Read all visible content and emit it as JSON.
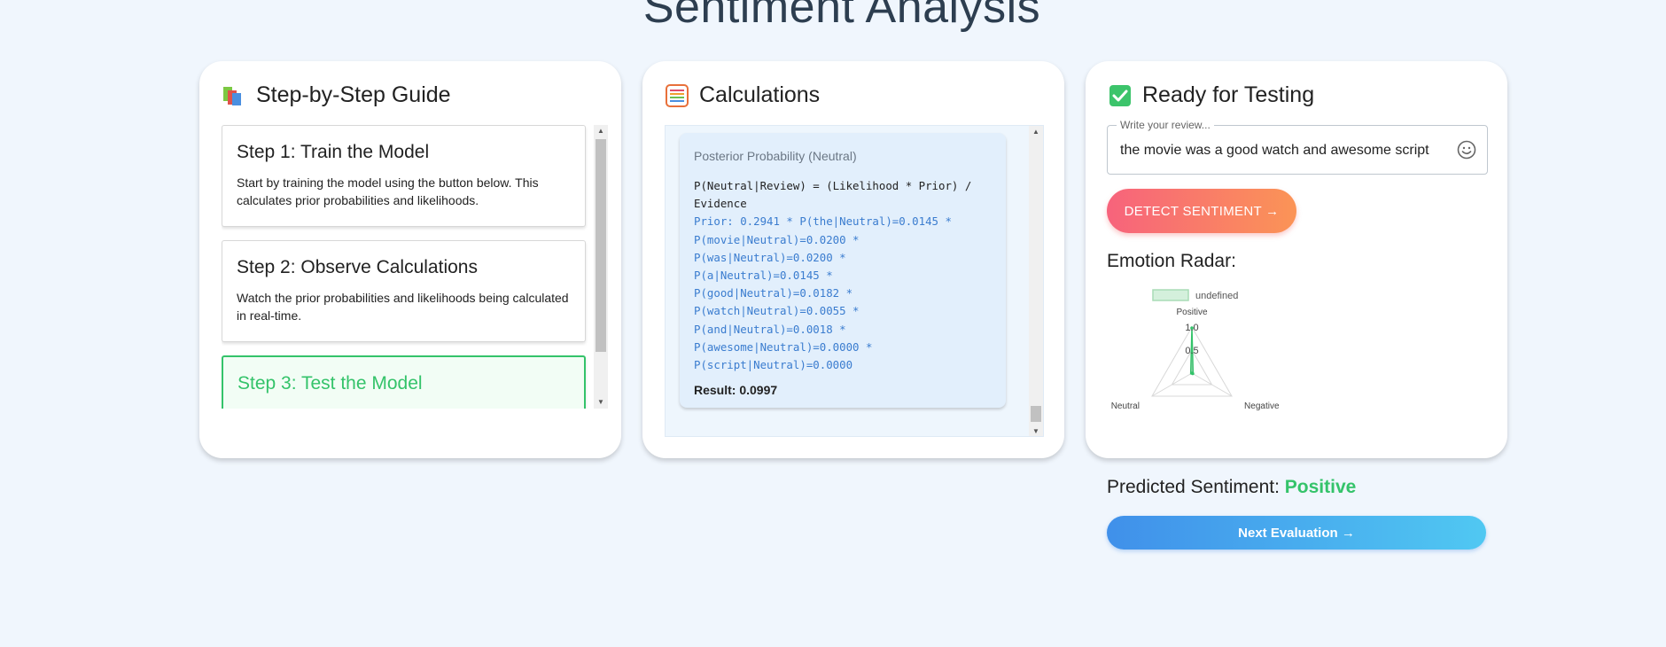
{
  "page": {
    "title": "Sentiment Analysis"
  },
  "guide": {
    "title": "Step-by-Step Guide",
    "icon": "books-icon",
    "steps": [
      {
        "title": "Step 1: Train the Model",
        "text": "Start by training the model using the button below. This calculates prior probabilities and likelihoods."
      },
      {
        "title": "Step 2: Observe Calculations",
        "text": "Watch the prior probabilities and likelihoods being calculated in real-time."
      },
      {
        "title": "Step 3: Test the Model",
        "active": true
      }
    ]
  },
  "calculations": {
    "title": "Calculations",
    "icon": "abacus-icon",
    "box_title": "Posterior Probability (Neutral)",
    "formula_lines": [
      "P(Neutral|Review) = (Likelihood * Prior) /",
      "Evidence"
    ],
    "detail_lines": [
      "Prior: 0.2941 * P(the|Neutral)=0.0145 *",
      "P(movie|Neutral)=0.0200 *",
      "P(was|Neutral)=0.0200 *",
      "P(a|Neutral)=0.0145 *",
      "P(good|Neutral)=0.0182 *",
      "P(watch|Neutral)=0.0055 *",
      "P(and|Neutral)=0.0018 *",
      "P(awesome|Neutral)=0.0000 *",
      "P(script|Neutral)=0.0000"
    ],
    "result": "Result: 0.0997"
  },
  "testing": {
    "title": "Ready for Testing",
    "icon": "check-box-icon",
    "review_label": "Write your review...",
    "review_value": "the movie was a good watch and awesome script",
    "detect_label": "DETECT SENTIMENT →",
    "radar_title": "Emotion Radar:",
    "predicted_label": "Predicted Sentiment:",
    "predicted_value": "Positive",
    "next_label": "Next Evaluation →"
  },
  "chart_data": {
    "type": "radar",
    "axes": [
      "Positive",
      "Negative",
      "Neutral"
    ],
    "series": [
      {
        "name": "undefined",
        "values": [
          0.98,
          0.02,
          0.0
        ]
      }
    ],
    "ticks": [
      "1.0",
      "0.5"
    ],
    "rlim": [
      0,
      1
    ],
    "legend": "top",
    "series_color": "#34c36a"
  }
}
